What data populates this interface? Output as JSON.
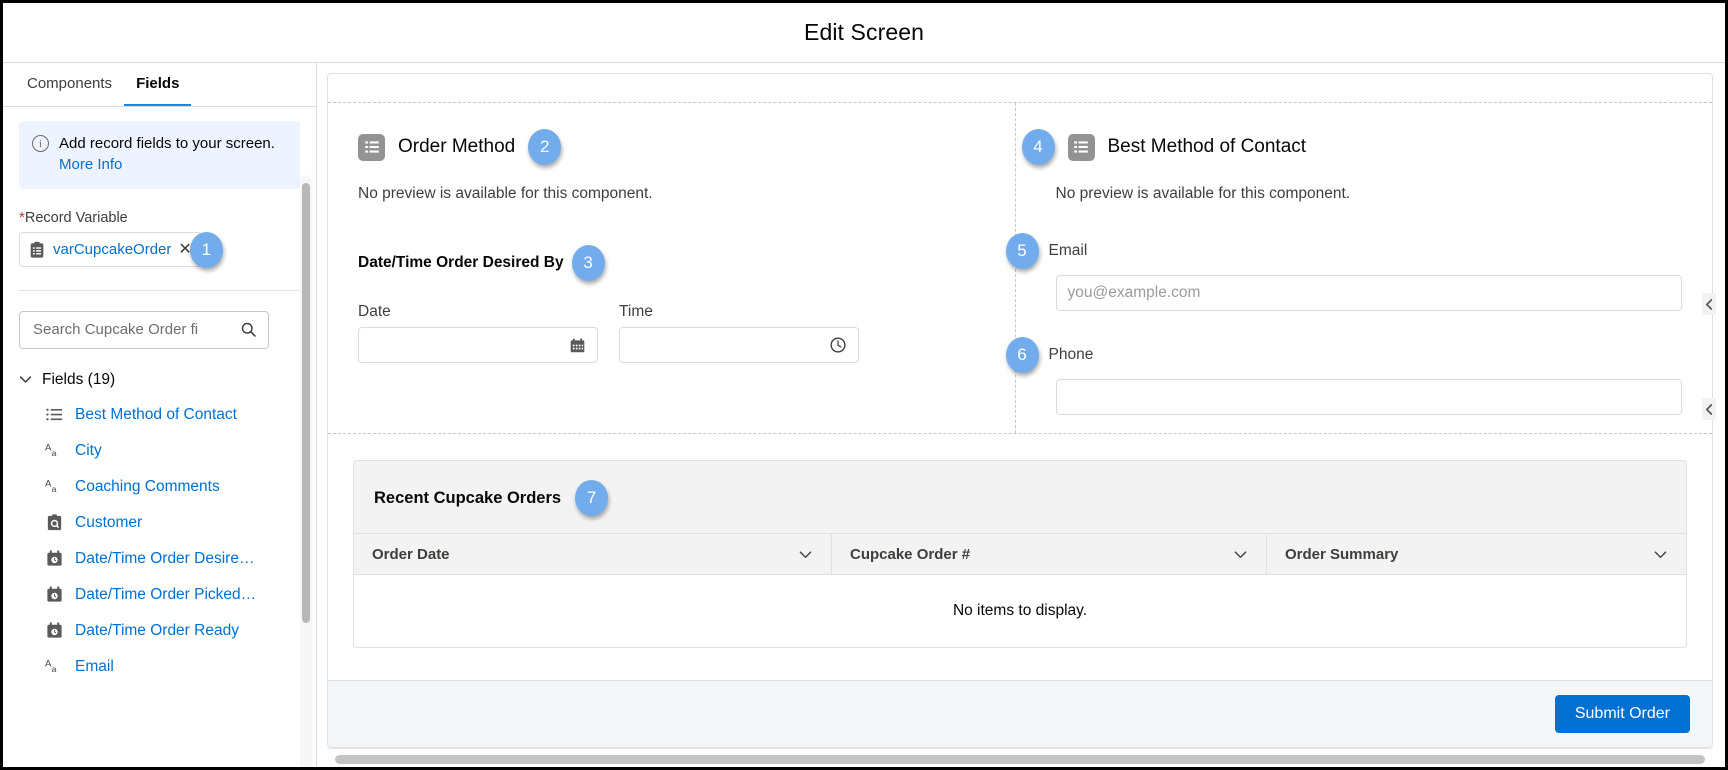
{
  "header": {
    "title": "Edit Screen"
  },
  "sidebar": {
    "tabs": [
      {
        "label": "Components",
        "active": false
      },
      {
        "label": "Fields",
        "active": true
      }
    ],
    "info": {
      "text": "Add record fields to your screen.",
      "link": "More Info"
    },
    "record_variable": {
      "label": "Record Variable",
      "required_mark": "*",
      "value": "varCupcakeOrder",
      "remove_glyph": "✕",
      "badge": "1"
    },
    "search": {
      "placeholder": "Search Cupcake Order fi"
    },
    "group": {
      "label": "Fields (19)"
    },
    "fields": [
      {
        "label": "Best Method of Contact",
        "icon": "picklist-icon"
      },
      {
        "label": "City",
        "icon": "text-icon"
      },
      {
        "label": "Coaching Comments",
        "icon": "text-icon"
      },
      {
        "label": "Customer",
        "icon": "lookup-icon"
      },
      {
        "label": "Date/Time Order Desire…",
        "icon": "datetime-icon"
      },
      {
        "label": "Date/Time Order Picked…",
        "icon": "datetime-icon"
      },
      {
        "label": "Date/Time Order Ready",
        "icon": "datetime-icon"
      },
      {
        "label": "Email",
        "icon": "text-icon"
      }
    ]
  },
  "canvas": {
    "left_component": {
      "title": "Order Method",
      "badge": "2",
      "no_preview": "No preview is available for this component.",
      "datetime_section": {
        "title": "Date/Time Order Desired By",
        "badge": "3",
        "date_label": "Date",
        "date_value": "",
        "time_label": "Time",
        "time_value": ""
      }
    },
    "right_component": {
      "title": "Best Method of Contact",
      "badge": "4",
      "no_preview": "No preview is available for this component.",
      "email": {
        "label": "Email",
        "badge": "5",
        "placeholder": "you@example.com",
        "value": ""
      },
      "phone": {
        "label": "Phone",
        "badge": "6",
        "placeholder": "",
        "value": ""
      }
    },
    "table": {
      "title": "Recent Cupcake Orders",
      "badge": "7",
      "columns": [
        "Order Date",
        "Cupcake Order #",
        "Order Summary"
      ],
      "empty_message": "No items to display.",
      "rows": []
    },
    "footer": {
      "submit_label": "Submit Order"
    }
  },
  "colors": {
    "accent_blue": "#0070d2",
    "badge_blue": "#72acec",
    "tab_underline": "#1589ee",
    "info_bg": "#eef4ff"
  }
}
